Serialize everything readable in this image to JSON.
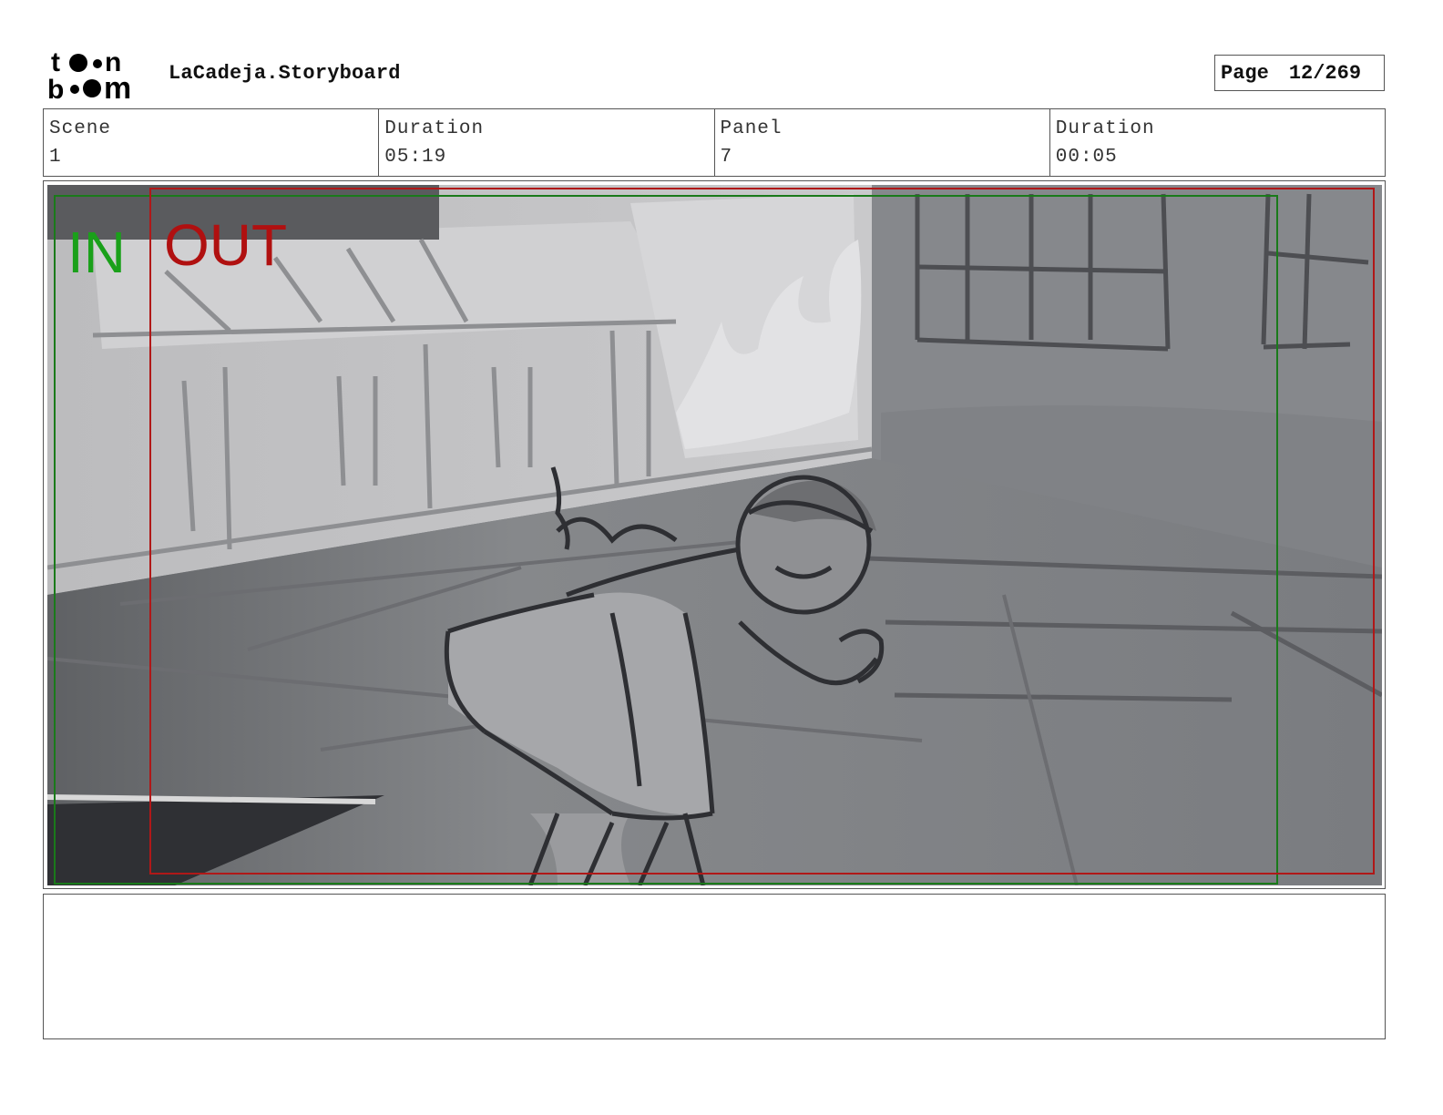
{
  "header": {
    "logo_text_top": "toon",
    "logo_text_bottom": "boom",
    "title": "LaCadeja.Storyboard",
    "page_label": "Page",
    "page_value": "12/269"
  },
  "info": {
    "scene_label": "Scene",
    "scene_value": "1",
    "scene_duration_label": "Duration",
    "scene_duration_value": "05:19",
    "panel_label": "Panel",
    "panel_value": "7",
    "panel_duration_label": "Duration",
    "panel_duration_value": "00:05"
  },
  "panel": {
    "in_label": "IN",
    "out_label": "OUT",
    "in_color": "#1aa01a",
    "out_color": "#b01010"
  },
  "notes": {
    "text": ""
  }
}
